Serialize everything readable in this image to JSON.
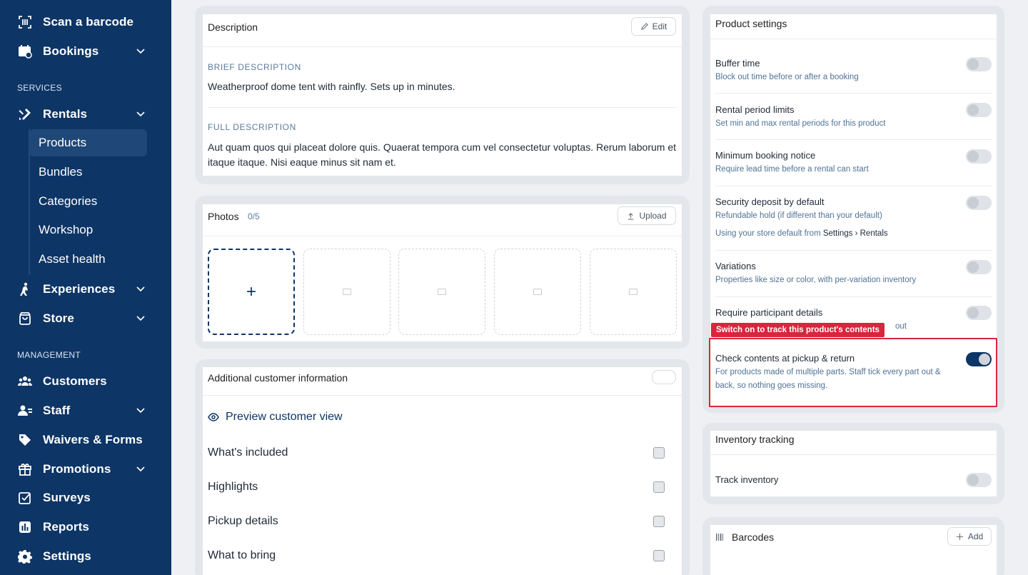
{
  "sidebar": {
    "scan": "Scan a barcode",
    "bookings": "Bookings",
    "services_label": "SERVICES",
    "rentals": "Rentals",
    "rentals_sub": [
      "Products",
      "Bundles",
      "Categories",
      "Workshop",
      "Asset health"
    ],
    "experiences": "Experiences",
    "store": "Store",
    "management_label": "MANAGEMENT",
    "customers": "Customers",
    "staff": "Staff",
    "waivers": "Waivers & Forms",
    "promotions": "Promotions",
    "surveys": "Surveys",
    "reports": "Reports",
    "settings": "Settings"
  },
  "description": {
    "title": "Description",
    "edit_label": "Edit",
    "brief_label": "BRIEF DESCRIPTION",
    "brief_text": "Weatherproof dome tent with rainfly. Sets up in minutes.",
    "full_label": "FULL DESCRIPTION",
    "full_text": "Aut quam quos qui placeat dolore quis. Quaerat tempora cum vel consectetur voluptas. Rerum laborum et itaque itaque. Nisi eaque minus sit nam et."
  },
  "photos": {
    "title": "Photos",
    "count": "0/5",
    "upload_label": "Upload",
    "add_symbol": "+"
  },
  "additional": {
    "title": "Additional customer information",
    "preview_label": "Preview customer view",
    "rows": [
      "What's included",
      "Highlights",
      "Pickup details",
      "What to bring"
    ]
  },
  "product_settings": {
    "title": "Product settings",
    "items": [
      {
        "title": "Buffer time",
        "desc": "Block out time before or after a booking",
        "on": false
      },
      {
        "title": "Rental period limits",
        "desc": "Set min and max rental periods for this product",
        "on": false
      },
      {
        "title": "Minimum booking notice",
        "desc": "Require lead time before a rental can start",
        "on": false
      },
      {
        "title": "Security deposit by default",
        "desc": "Refundable hold (if different than your default)",
        "on": false
      },
      {
        "title": "Variations",
        "desc": "Properties like size or color, with per-variation inventory",
        "on": false
      },
      {
        "title": "Require participant details",
        "desc": "out",
        "on": false
      },
      {
        "title": "Check contents at pickup & return",
        "desc": "For products made of multiple parts. Staff tick every part out & back, so nothing goes missing.",
        "on": true
      }
    ],
    "deposit_note_prefix": "Using your store default from",
    "deposit_note_path": "Settings › Rentals",
    "callout": "Switch on to track this product's contents",
    "accent": "#d7263d"
  },
  "inventory": {
    "title": "Inventory tracking",
    "track_label": "Track inventory",
    "on": false
  },
  "barcodes": {
    "title": "Barcodes",
    "add_label": "Add"
  }
}
